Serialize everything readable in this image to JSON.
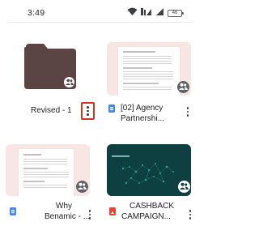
{
  "status_bar": {
    "time": "3:49",
    "battery": "46"
  },
  "files": [
    {
      "name": "Revised - 1",
      "type": "folder",
      "shared": true,
      "menu_highlighted": true
    },
    {
      "name": "[02] Agency Partnershi...",
      "name_line1": "[02] Agency",
      "name_line2": "Partnershi...",
      "type": "document",
      "icon": "docs-icon",
      "shared": true
    },
    {
      "name": "Why Benamic - ...",
      "name_line1": "Why",
      "name_line2": "Benamic - ...",
      "type": "document",
      "icon": "docs-icon",
      "shared": true
    },
    {
      "name": "CASHBACK CAMPAIGN...",
      "name_line1": "CASHBACK",
      "name_line2": "CAMPAIGN...",
      "type": "slides",
      "icon": "slides-icon",
      "shared": true
    }
  ],
  "colors": {
    "folder": "#5b4544",
    "doc_blue": "#4285f4",
    "slides_red": "#ea4335",
    "highlight_red": "#d93025",
    "thumb_bg": "#f7e6e3",
    "slide_bg": "#0e3f41"
  }
}
